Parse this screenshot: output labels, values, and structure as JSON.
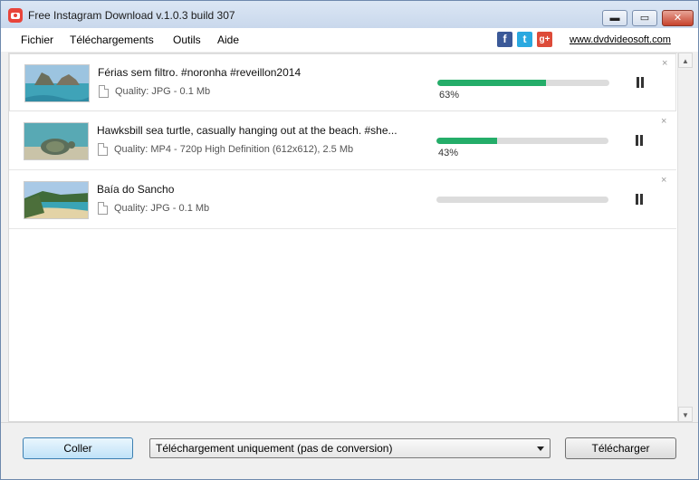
{
  "window": {
    "title": "Free Instagram Download  v.1.0.3 build 307",
    "controls": {
      "minimize": "▬",
      "maximize": "▭",
      "close": "✕"
    }
  },
  "menu": {
    "items": [
      {
        "label": "Fichier"
      },
      {
        "label": "Téléchargements"
      },
      {
        "label": "Outils"
      },
      {
        "label": "Aide"
      }
    ],
    "social": [
      {
        "icon": "facebook-icon",
        "glyph": "f",
        "color": "#3b5998"
      },
      {
        "icon": "twitter-icon",
        "glyph": "t",
        "color": "#2aa9e0"
      },
      {
        "icon": "google-plus-icon",
        "glyph": "g+",
        "color": "#dd4b39"
      }
    ],
    "site_link": "www.dvdvideosoft.com"
  },
  "downloads": [
    {
      "title": "Férias sem filtro. #noronha #reveillon2014",
      "info": "Quality: JPG - 0.1 Mb",
      "progress": 0.63,
      "percent_label": "63%",
      "thumbnail": "beach-rocks-thumbnail"
    },
    {
      "title": "Hawksbill sea turtle, casually hanging out at the beach. #she...",
      "info": "Quality: MP4 - 720p High Definition (612x612), 2.5 Mb",
      "progress": 0.35,
      "percent_label": "43%",
      "thumbnail": "sea-turtle-thumbnail"
    },
    {
      "title": "Baía do Sancho",
      "info": "Quality: JPG - 0.1 Mb",
      "progress": 0,
      "percent_label": "",
      "thumbnail": "bay-thumbnail"
    }
  ],
  "row_controls": {
    "pause_icon": "pause-icon",
    "remove_glyph": "×"
  },
  "footer": {
    "paste_label": "Coller",
    "mode_select": "Téléchargement uniquement (pas de conversion)",
    "download_label": "Télécharger"
  },
  "colors": {
    "progress": "#24ad69",
    "accent": "#3c7fb1"
  }
}
